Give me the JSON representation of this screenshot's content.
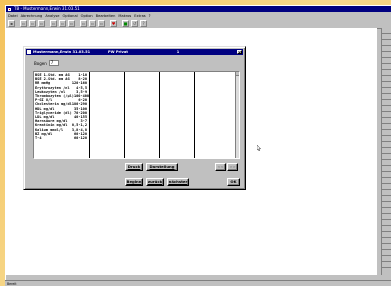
{
  "app": {
    "title": "TB - Mustermann,Erwin 31.03.51",
    "menu": [
      "Datei",
      "Abrechnung",
      "Analyse",
      "Optional",
      "Option",
      "Bearbeiten",
      "Makros",
      "Extras",
      "?"
    ],
    "toolbar_icons": [
      "save-icon",
      "print-icon",
      "copy-icon",
      "cut-icon",
      "paste-icon",
      "find-icon",
      "chart-icon",
      "info-icon",
      "calendar-icon",
      "heart-icon",
      "lab-icon",
      "letter-icon",
      "refresh-icon",
      "help-icon"
    ],
    "status": "Bereit"
  },
  "dialog": {
    "title_name": "Mustermann,Erwin 31.03.51",
    "title_module": "PW Privat",
    "title_num": "1",
    "bogen_label": "Bogen",
    "bogen_value": "7",
    "rows": [
      {
        "label": "BSE 1.Std. mm AG",
        "value": "1-10"
      },
      {
        "label": "BSE 2.Std. mm AG",
        "value": "8-20"
      },
      {
        "label": "RR mmHg",
        "value": "120-160"
      },
      {
        "label": "Erythrozyten /nl",
        "value": "4-5,5"
      },
      {
        "label": "Leukozyten /nl",
        "value": "3,5-9"
      },
      {
        "label": "Thrombozyten (/µl)",
        "value": "100-400"
      },
      {
        "label": "P-GI U/l",
        "value": "6-20"
      },
      {
        "label": "Cholesterin mg/dl",
        "value": "180-290"
      },
      {
        "label": "HDL mg/dl",
        "value": "35-100"
      },
      {
        "label": "Triglyceride (dl)",
        "value": "70-200"
      },
      {
        "label": "LDL mg/dl",
        "value": "40-155"
      },
      {
        "label": "Harnsäure mg/dl",
        "value": "3-7"
      },
      {
        "label": "Kreatinin mg/dl",
        "value": "0,5-1,2"
      },
      {
        "label": "Kalium mmol/l",
        "value": "3,8-4,8"
      },
      {
        "label": "BZ mg/dl",
        "value": "60-120"
      },
      {
        "label": "T-4",
        "value": "60-120"
      }
    ],
    "buttons": {
      "druck": "Druck",
      "darstellung": "Darstellung",
      "beginn": "Beginn",
      "zurueck": "zurück",
      "naechster": "nächster",
      "ok": "OK",
      "prev": "<<",
      "next": ">>"
    }
  }
}
